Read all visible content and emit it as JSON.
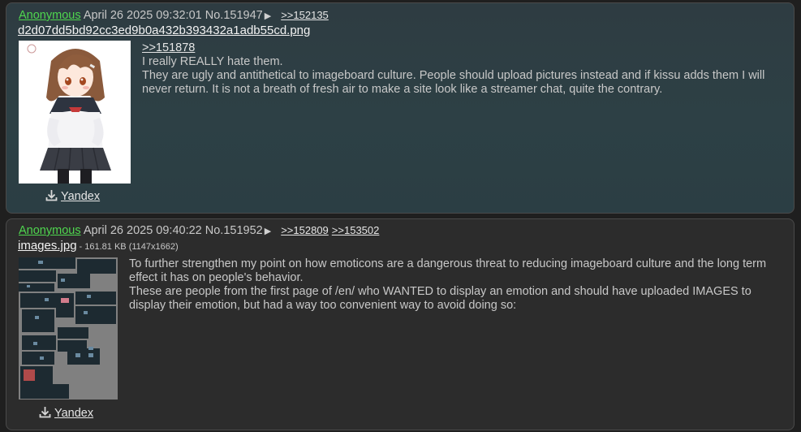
{
  "posts": [
    {
      "name": "Anonymous",
      "date": "April 26 2025 09:32:01",
      "number": "No.151947",
      "arrow": "▶",
      "backlinks": [
        ">>152135"
      ],
      "file": {
        "name": "d2d07dd5bd92cc3ed9b0a432b393432a1adb55cd.png",
        "info": ""
      },
      "search_label": "Yandex",
      "quote": ">>151878",
      "lines": [
        "I really REALLY hate them.",
        "They are ugly and antithetical to imageboard culture. People should upload pictures instead and if kissu adds them I will never return. It is not a breath of fresh air to make a site look like a streamer chat, quite the contrary."
      ]
    },
    {
      "name": "Anonymous",
      "date": "April 26 2025 09:40:22",
      "number": "No.151952",
      "arrow": "▶",
      "backlinks": [
        ">>152809",
        ">>153502"
      ],
      "file": {
        "name": "images.jpg",
        "info": "- 161.81 KB (1147x1662)"
      },
      "search_label": "Yandex",
      "lines": [
        "To further strengthen my point on how emoticons are a dangerous threat to reducing imageboard culture and the long term effect it has on people's behavior.",
        "These are people from the first page of /en/ who WANTED to display an emotion and should have uploaded IMAGES to display their emotion, but had a way too convenient way to avoid doing so:"
      ]
    }
  ],
  "colors": {
    "name": "#4fd64f",
    "post1_bg": "#2d4045",
    "post2_bg": "#2c2c2c",
    "page_bg": "#1f1f1f"
  },
  "icons": {
    "download": "download-icon",
    "arrow": "triangle-right-icon"
  }
}
